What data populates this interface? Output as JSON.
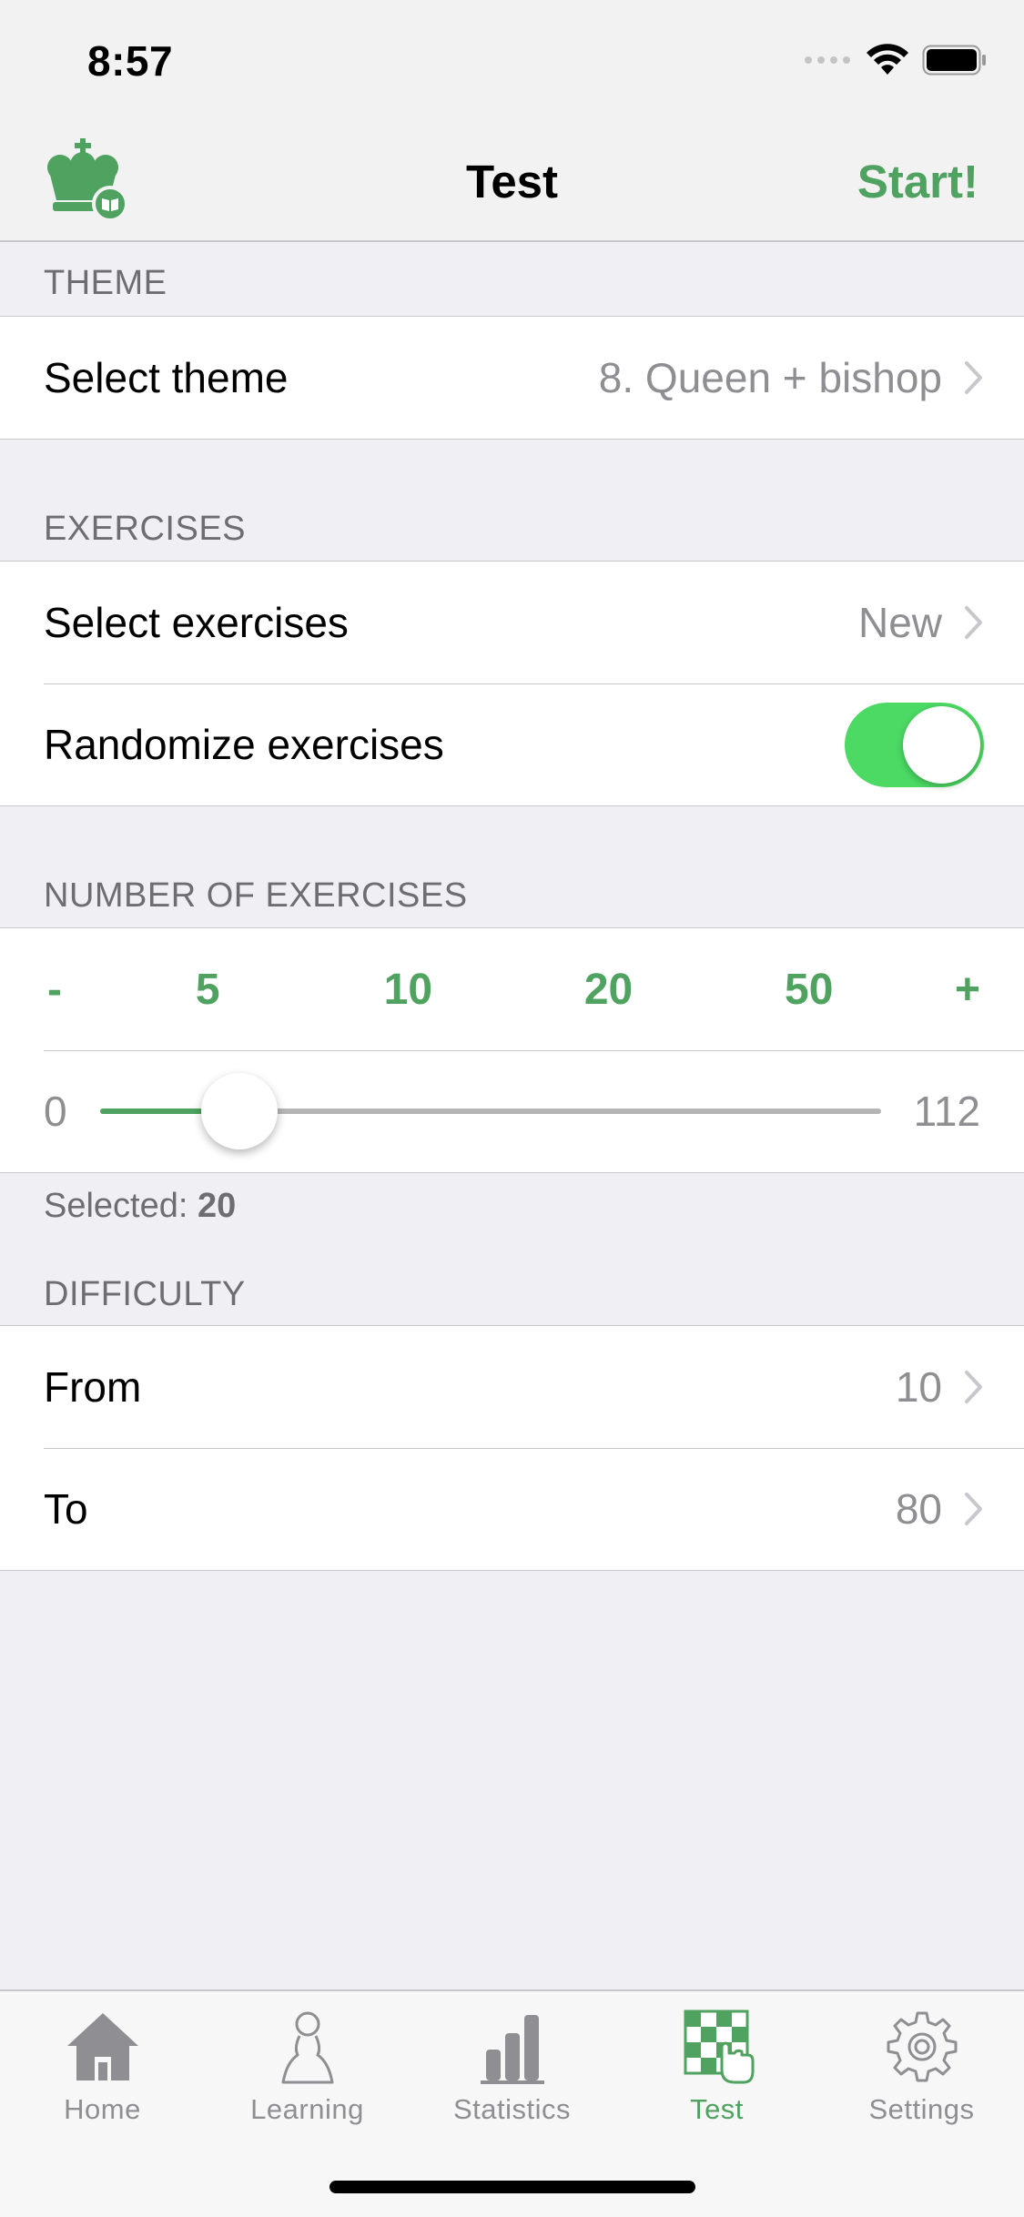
{
  "status": {
    "time": "8:57"
  },
  "nav": {
    "title": "Test",
    "start": "Start!"
  },
  "theme_section": {
    "header": "THEME",
    "select_label": "Select theme",
    "select_value": "8. Queen + bishop"
  },
  "exercises_section": {
    "header": "EXERCISES",
    "select_label": "Select exercises",
    "select_value": "New",
    "randomize_label": "Randomize exercises",
    "randomize_on": true
  },
  "number_section": {
    "header": "NUMBER OF EXERCISES",
    "minus": "-",
    "presets": [
      "5",
      "10",
      "20",
      "50"
    ],
    "plus": "+",
    "slider_min": "0",
    "slider_max": "112",
    "slider_value": 20,
    "selected_prefix": "Selected: ",
    "selected_value": "20"
  },
  "difficulty_section": {
    "header": "DIFFICULTY",
    "from_label": "From",
    "from_value": "10",
    "to_label": "To",
    "to_value": "80"
  },
  "tabbar": {
    "items": [
      {
        "label": "Home",
        "icon": "home-icon"
      },
      {
        "label": "Learning",
        "icon": "pawn-icon"
      },
      {
        "label": "Statistics",
        "icon": "bar-chart-icon"
      },
      {
        "label": "Test",
        "icon": "chessboard-hand-icon"
      },
      {
        "label": "Settings",
        "icon": "gear-icon"
      }
    ],
    "active": "Test"
  },
  "colors": {
    "accent": "#4fa25f",
    "toggle_on": "#4cd964",
    "background": "#efeff4"
  }
}
